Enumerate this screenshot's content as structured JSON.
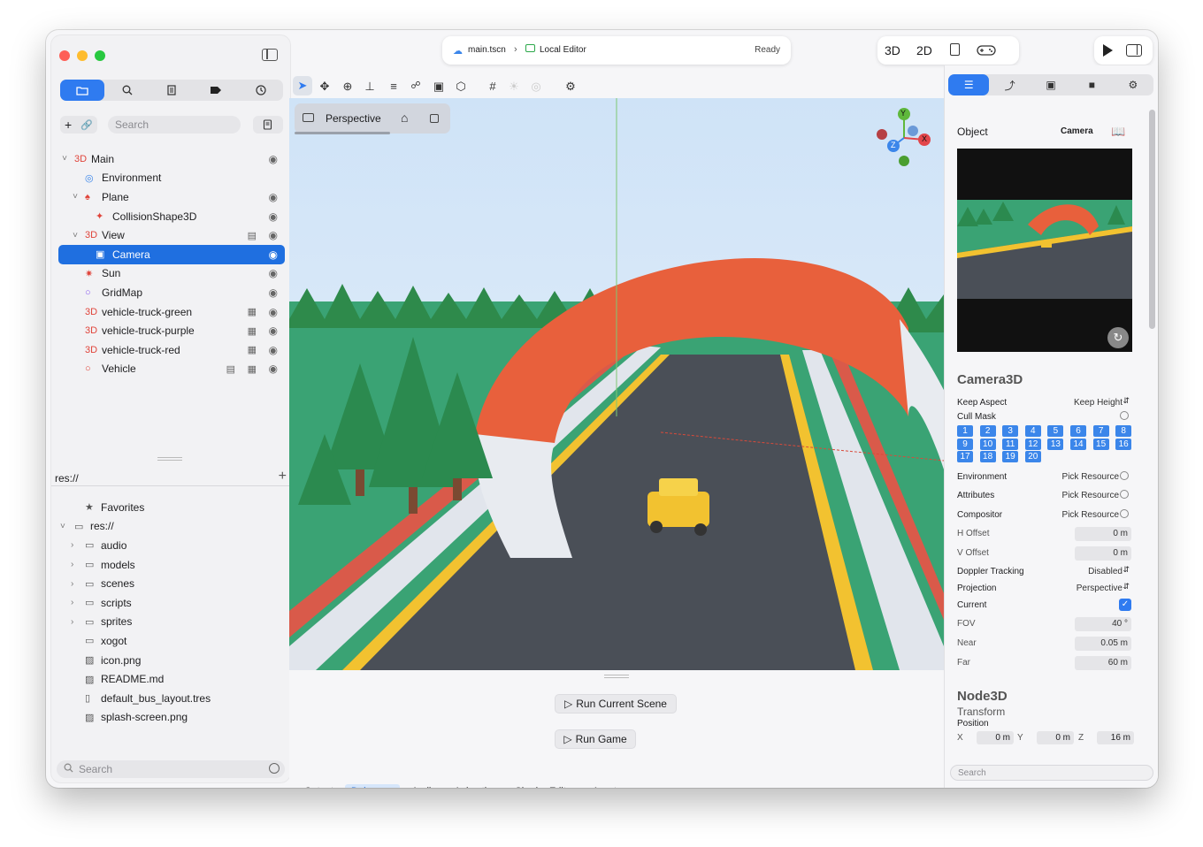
{
  "toolbar": {
    "file_name": "main.tscn",
    "file_sep": "›",
    "editor_mode": "Local Editor",
    "status": "Ready",
    "view_3d": "3D",
    "view_2d": "2D"
  },
  "sidebar": {
    "search_placeholder": "Search",
    "scene_tree": [
      {
        "label": "Main",
        "prefix": "3D",
        "indent": 0,
        "chevron": "˅",
        "eye": true,
        "extra": ""
      },
      {
        "label": "Environment",
        "prefix": "",
        "indent": 1,
        "chevron": "",
        "eye": false,
        "extra": ""
      },
      {
        "label": "Plane",
        "prefix": "",
        "indent": 1,
        "chevron": "˅",
        "eye": true,
        "extra": ""
      },
      {
        "label": "CollisionShape3D",
        "prefix": "",
        "indent": 2,
        "chevron": "",
        "eye": true,
        "extra": ""
      },
      {
        "label": "View",
        "prefix": "3D",
        "indent": 1,
        "chevron": "˅",
        "eye": true,
        "extra": "script"
      },
      {
        "label": "Camera",
        "prefix": "",
        "indent": 2,
        "chevron": "",
        "eye": true,
        "extra": "",
        "selected": true
      },
      {
        "label": "Sun",
        "prefix": "",
        "indent": 1,
        "chevron": "",
        "eye": true,
        "extra": ""
      },
      {
        "label": "GridMap",
        "prefix": "",
        "indent": 1,
        "chevron": "",
        "eye": true,
        "extra": ""
      },
      {
        "label": "vehicle-truck-green",
        "prefix": "3D",
        "indent": 1,
        "chevron": "",
        "eye": true,
        "extra": "scene"
      },
      {
        "label": "vehicle-truck-purple",
        "prefix": "3D",
        "indent": 1,
        "chevron": "",
        "eye": true,
        "extra": "scene"
      },
      {
        "label": "vehicle-truck-red",
        "prefix": "3D",
        "indent": 1,
        "chevron": "",
        "eye": true,
        "extra": "scene"
      },
      {
        "label": "Vehicle",
        "prefix": "",
        "indent": 1,
        "chevron": "",
        "eye": true,
        "extra": "both"
      }
    ],
    "res_path": "res://",
    "files": [
      {
        "label": "Favorites",
        "indent": 1,
        "chevron": "",
        "icon": "star"
      },
      {
        "label": "res://",
        "indent": 0,
        "chevron": "˅",
        "icon": "folder"
      },
      {
        "label": "audio",
        "indent": 1,
        "chevron": "›",
        "icon": "folder"
      },
      {
        "label": "models",
        "indent": 1,
        "chevron": "›",
        "icon": "folder"
      },
      {
        "label": "scenes",
        "indent": 1,
        "chevron": "›",
        "icon": "folder"
      },
      {
        "label": "scripts",
        "indent": 1,
        "chevron": "›",
        "icon": "folder"
      },
      {
        "label": "sprites",
        "indent": 1,
        "chevron": "›",
        "icon": "folder"
      },
      {
        "label": "xogot",
        "indent": 1,
        "chevron": "",
        "icon": "folder"
      },
      {
        "label": "icon.png",
        "indent": 1,
        "chevron": "",
        "icon": "image"
      },
      {
        "label": "README.md",
        "indent": 1,
        "chevron": "",
        "icon": "image"
      },
      {
        "label": "default_bus_layout.tres",
        "indent": 1,
        "chevron": "",
        "icon": "doc"
      },
      {
        "label": "splash-screen.png",
        "indent": 1,
        "chevron": "",
        "icon": "image"
      }
    ],
    "bottom_search_placeholder": "Search"
  },
  "viewport": {
    "mode_label": "Perspective",
    "gizmo_x": "X",
    "gizmo_y": "Y",
    "gizmo_z": "Z"
  },
  "bottom_panel": {
    "run_current_scene": "Run Current Scene",
    "run_game": "Run Game",
    "tabs": [
      "Output",
      "Debugger",
      "Audio",
      "Animation",
      "Shader Editor",
      "Assets"
    ],
    "active_tab": "Debugger"
  },
  "inspector": {
    "object_label": "Object",
    "object_value": "Camera",
    "class_title": "Camera3D",
    "keep_aspect_label": "Keep Aspect",
    "keep_aspect_value": "Keep Height",
    "cull_mask_label": "Cull Mask",
    "cull_mask_layers": [
      "1",
      "2",
      "3",
      "4",
      "5",
      "6",
      "7",
      "8",
      "9",
      "10",
      "11",
      "12",
      "13",
      "14",
      "15",
      "16",
      "17",
      "18",
      "19",
      "20"
    ],
    "environment_label": "Environment",
    "attributes_label": "Attributes",
    "compositor_label": "Compositor",
    "pick_resource": "Pick Resource",
    "h_offset_label": "H Offset",
    "h_offset_value": "0 m",
    "v_offset_label": "V Offset",
    "v_offset_value": "0 m",
    "doppler_label": "Doppler Tracking",
    "doppler_value": "Disabled",
    "projection_label": "Projection",
    "projection_value": "Perspective",
    "current_label": "Current",
    "current_checked": true,
    "fov_label": "FOV",
    "fov_value": "40 °",
    "near_label": "Near",
    "near_value": "0.05 m",
    "far_label": "Far",
    "far_value": "60 m",
    "node3d_title": "Node3D",
    "transform_label": "Transform",
    "position_label": "Position",
    "pos_x_label": "X",
    "pos_x_value": "0 m",
    "pos_y_label": "Y",
    "pos_y_value": "0 m",
    "pos_z_label": "Z",
    "pos_z_value": "16 m",
    "search_placeholder": "Search"
  },
  "colors": {
    "accent": "#2f7bf0",
    "selection": "#1f6fe0",
    "prefix_3d": "#e0443a",
    "arch_orange": "#e8603c",
    "road": "#4a4f57",
    "grass": "#3aa374"
  }
}
